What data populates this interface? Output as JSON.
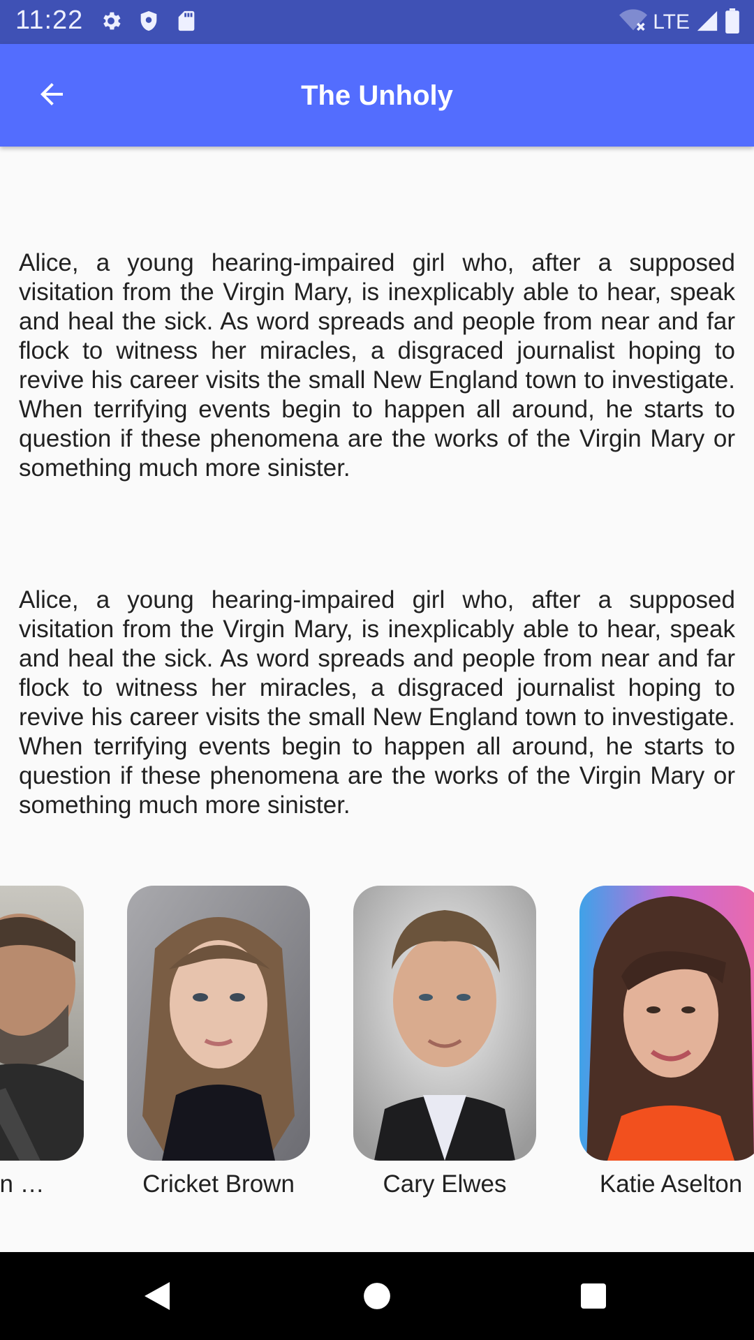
{
  "status_bar": {
    "time": "11:22",
    "network": "LTE",
    "icons_left": [
      "gear-icon",
      "shield-icon",
      "sd-card-icon"
    ],
    "icons_right": [
      "wifi-off-icon",
      "signal-icon",
      "battery-icon"
    ]
  },
  "app_bar": {
    "title": "The Unholy",
    "back_icon": "arrow-left-icon",
    "color": "#536dfe",
    "status_color": "#3f51b5"
  },
  "overview": {
    "top_fragment": "sinister.",
    "paragraphs": [
      "Alice, a young hearing-impaired girl who, after a supposed visitation from the Virgin Mary, is inexplicably able to hear, speak and heal the sick. As word spreads and people from near and far flock to witness her miracles, a disgraced journalist hoping to revive his career visits the small New England town to investigate. When terrifying events begin to happen all around, he starts to question if these phenomena are the works of the Virgin Mary or something much more sinister.",
      "Alice, a young hearing-impaired girl who, after a supposed visitation from the Virgin Mary, is inexplicably able to hear, speak and heal the sick. As word spreads and people from near and far flock to witness her miracles, a disgraced journalist hoping to revive his career visits the small New England town to investigate. When terrifying events begin to happen all around, he starts to question if these phenomena are the works of the Virgin Mary or something much more sinister."
    ]
  },
  "cast": [
    {
      "name": "an …",
      "photo": "actor-photo"
    },
    {
      "name": "Cricket Brown",
      "photo": "actor-photo"
    },
    {
      "name": "Cary Elwes",
      "photo": "actor-photo"
    },
    {
      "name": "Katie Aselton",
      "photo": "actor-photo"
    }
  ],
  "nav_bar": {
    "buttons": [
      "back-triangle-icon",
      "home-circle-icon",
      "recents-square-icon"
    ]
  }
}
